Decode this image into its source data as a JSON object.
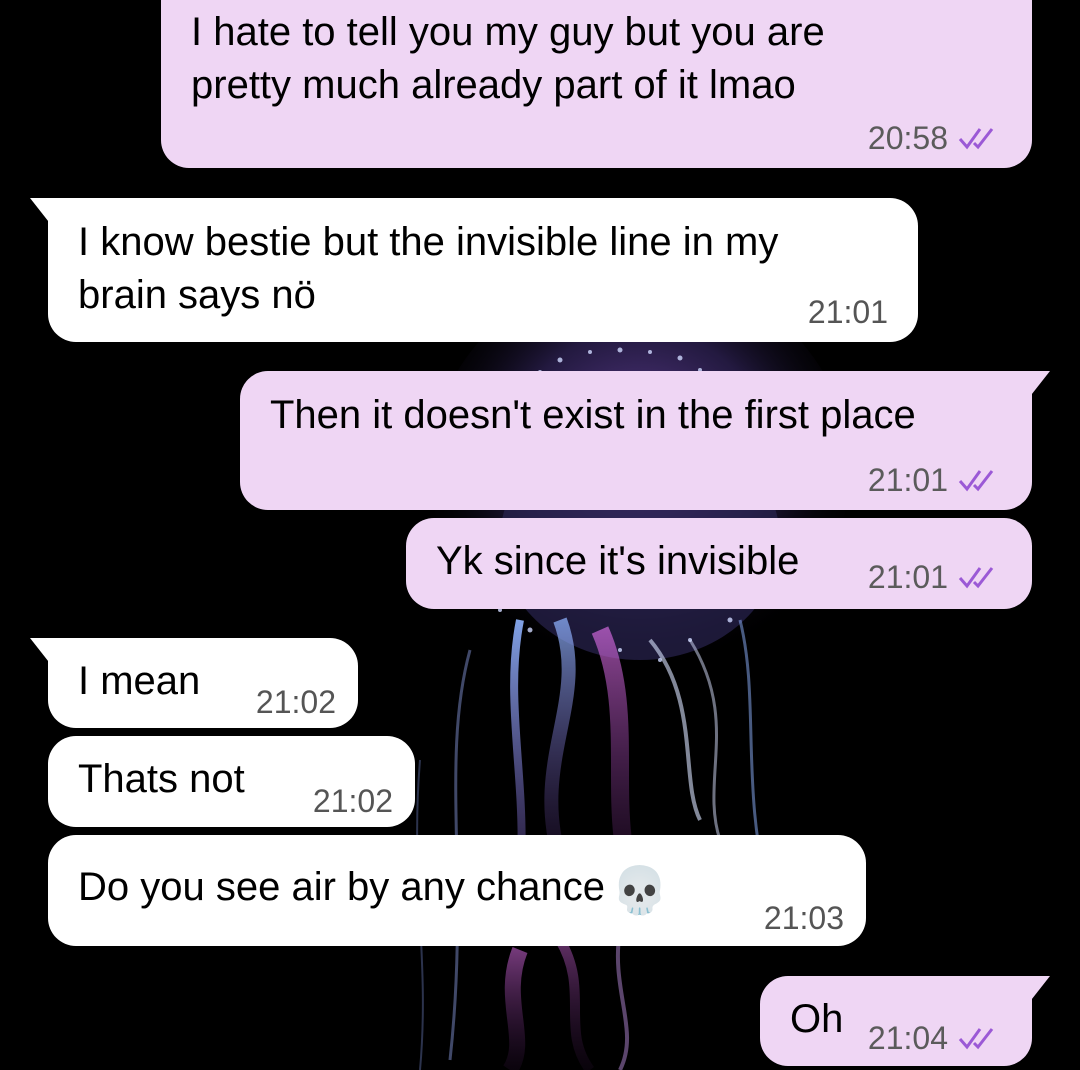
{
  "colors": {
    "background": "#000000",
    "outgoing_bubble": "#efd6f4",
    "incoming_bubble": "#ffffff",
    "read_ticks": "#9b59d6"
  },
  "messages": [
    {
      "direction": "outgoing",
      "lines": [
        "I hate to tell you my guy but you are",
        "pretty much already part of it lmao"
      ],
      "time": "20:58",
      "status": "read",
      "tail": false
    },
    {
      "direction": "incoming",
      "lines": [
        "I know bestie but the invisible line in my",
        "brain says nö"
      ],
      "time": "21:01",
      "tail": true
    },
    {
      "direction": "outgoing",
      "lines": [
        "Then it doesn't exist in the first place"
      ],
      "time": "21:01",
      "status": "read",
      "tail": true
    },
    {
      "direction": "outgoing",
      "lines": [
        "Yk since it's invisible"
      ],
      "time": "21:01",
      "status": "read",
      "tail": false
    },
    {
      "direction": "incoming",
      "lines": [
        "I mean"
      ],
      "time": "21:02",
      "tail": true
    },
    {
      "direction": "incoming",
      "lines": [
        "Thats not"
      ],
      "time": "21:02",
      "tail": false
    },
    {
      "direction": "incoming",
      "lines": [
        "Do you see air by any chance"
      ],
      "emoji": "skull",
      "time": "21:03",
      "tail": false
    },
    {
      "direction": "outgoing",
      "lines": [
        "Oh"
      ],
      "time": "21:04",
      "status": "read",
      "tail": true
    }
  ]
}
